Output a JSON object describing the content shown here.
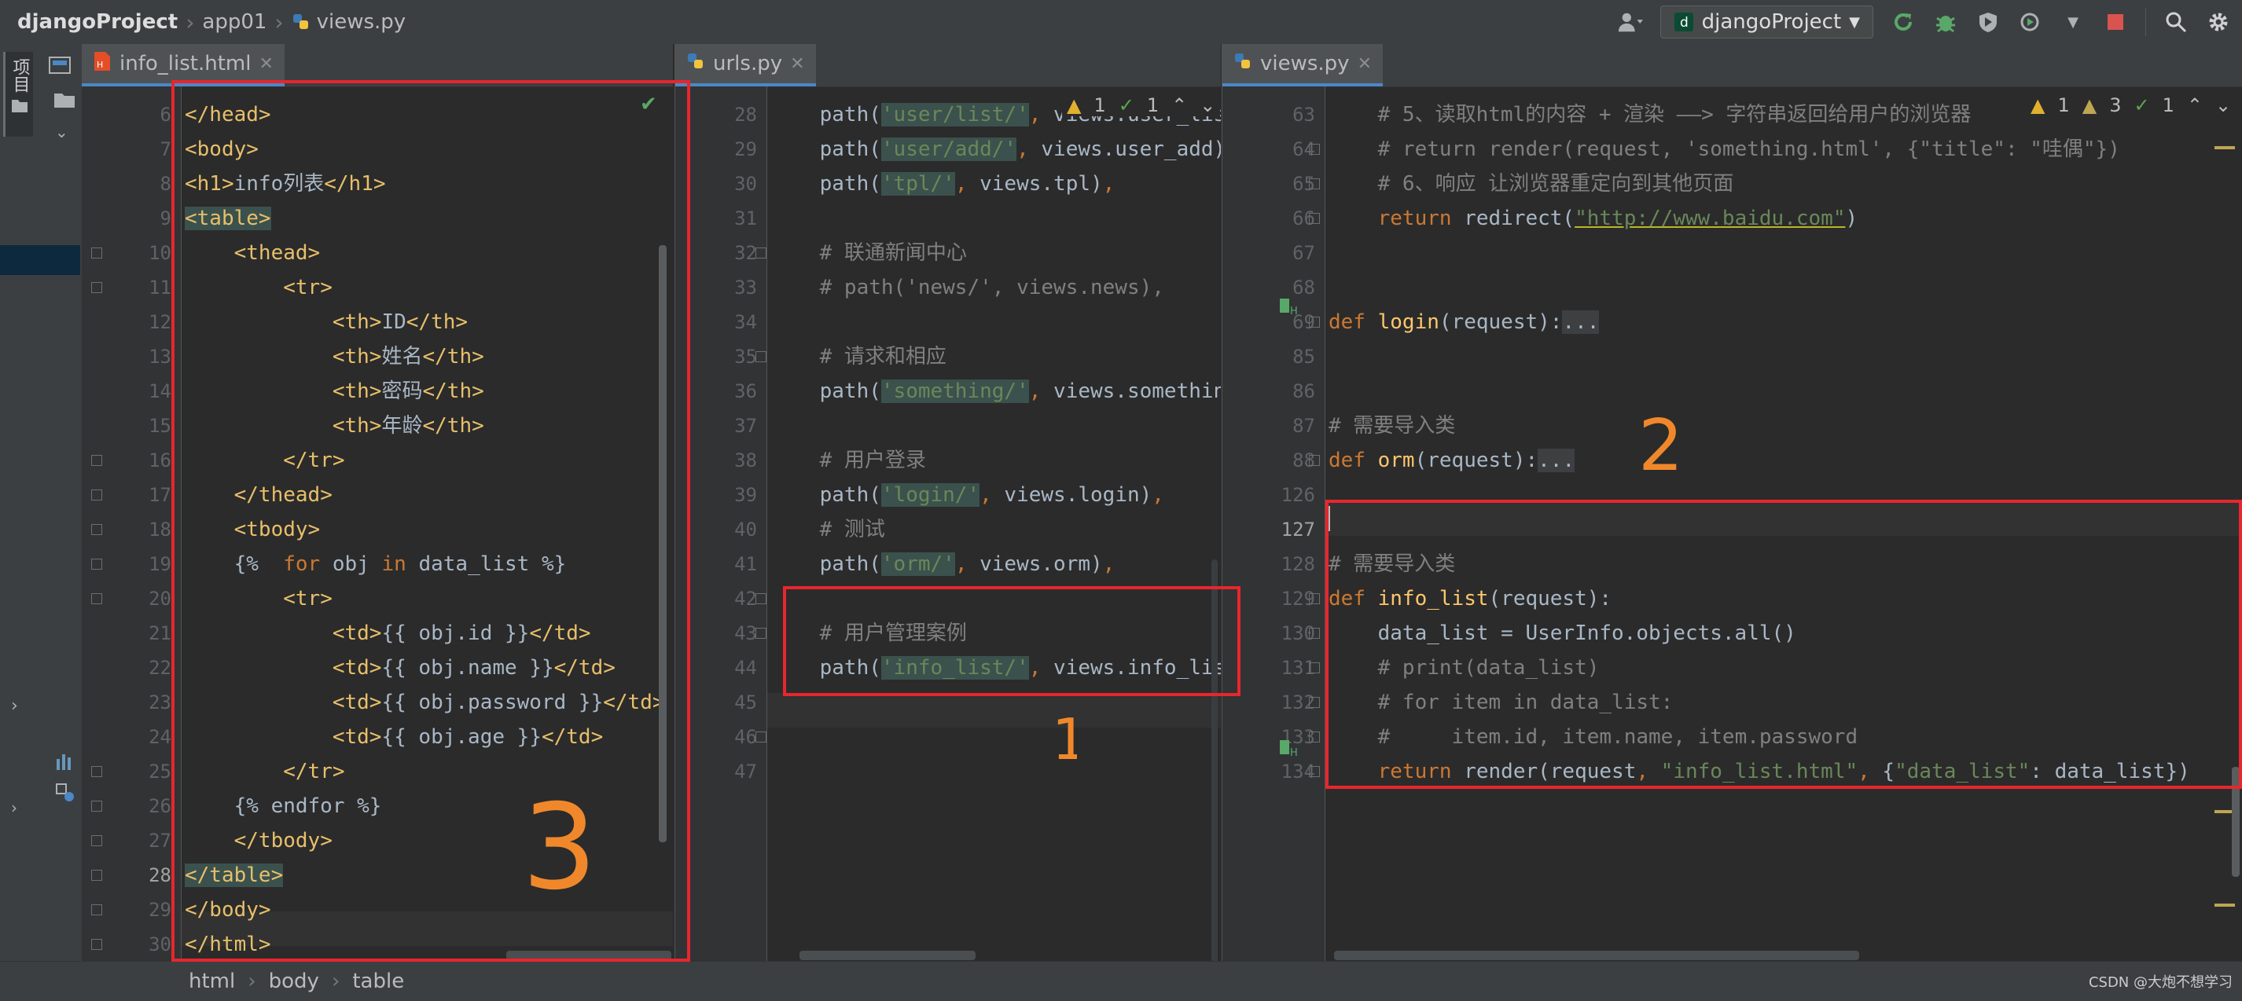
{
  "breadcrumb": {
    "project": "djangoProject",
    "folder": "app01",
    "file": "views.py"
  },
  "toolbar": {
    "run_config": "djangoProject"
  },
  "sidebar": {
    "project_label": "项目"
  },
  "panes": {
    "left": {
      "tab": "info_list.html",
      "line_numbers": [
        "6",
        "7",
        "8",
        "9",
        "10",
        "11",
        "12",
        "13",
        "14",
        "15",
        "16",
        "17",
        "18",
        "19",
        "20",
        "21",
        "22",
        "23",
        "24",
        "25",
        "26",
        "27",
        "28",
        "29",
        "30"
      ],
      "current_line": "28"
    },
    "middle": {
      "tab": "urls.py",
      "line_numbers": [
        "28",
        "29",
        "30",
        "31",
        "32",
        "33",
        "34",
        "35",
        "36",
        "37",
        "38",
        "39",
        "40",
        "41",
        "42",
        "43",
        "44",
        "45",
        "46",
        "47"
      ],
      "inspection": {
        "warnings": "1",
        "weak": "1"
      }
    },
    "right": {
      "tab": "views.py",
      "line_numbers": [
        "63",
        "64",
        "65",
        "66",
        "67",
        "68",
        "69",
        "85",
        "86",
        "87",
        "88",
        "126",
        "127",
        "128",
        "129",
        "130",
        "131",
        "132",
        "133",
        "134"
      ],
      "current_line": "127",
      "inspection": {
        "warnings": "1",
        "weak_warnings": "3",
        "typos": "1"
      }
    }
  },
  "code": {
    "left": [
      "</head>",
      "<body>",
      "<h1>info列表</h1>",
      "<table>",
      "    <thead>",
      "        <tr>",
      "            <th>ID</th>",
      "            <th>姓名</th>",
      "            <th>密码</th>",
      "            <th>年龄</th>",
      "        </tr>",
      "    </thead>",
      "    <tbody>",
      "    {%  for obj in data_list %}",
      "        <tr>",
      "            <td>{{ obj.id }}</td>",
      "            <td>{{ obj.name }}</td>",
      "            <td>{{ obj.password }}</td>",
      "            <td>{{ obj.age }}</td>",
      "        </tr>",
      "    {% endfor %}",
      "    </tbody>",
      "</table>",
      "</body>",
      "</html>"
    ],
    "middle": [
      "    path('user/list/', views.user_list),",
      "    path('user/add/', views.user_add),",
      "    path('tpl/', views.tpl),",
      "",
      "    # 联通新闻中心",
      "    # path('news/', views.news),",
      "",
      "    # 请求和相应",
      "    path('something/', views.something),",
      "",
      "    # 用户登录",
      "    path('login/', views.login),",
      "    # 测试",
      "    path('orm/', views.orm),",
      "",
      "    # 用户管理案例",
      "    path('info_list/', views.info_list),",
      "",
      "",
      ""
    ],
    "right": [
      "    # 5、读取html的内容 + 渲染 ——> 字符串返回给用户的浏览器",
      "    # return render(request, 'something.html', {\"title\": \"哇偶\"})",
      "    # 6、响应 让浏览器重定向到其他页面",
      "    return redirect(\"http://www.baidu.com\")",
      "",
      "",
      "def login(request):...",
      "",
      "",
      "# 需要导入类",
      "def orm(request):...",
      "",
      "",
      "# 需要导入类",
      "def info_list(request):",
      "    data_list = UserInfo.objects.all()",
      "    # print(data_list)",
      "    # for item in data_list:",
      "    #     item.id, item.name, item.password",
      "    return render(request, \"info_list.html\", {\"data_list\": data_list})"
    ]
  },
  "status": {
    "path": [
      "html",
      "body",
      "table"
    ],
    "watermark": "CSDN @大炮不想学习"
  },
  "annotations": {
    "mark1": "1",
    "mark2": "2",
    "mark3": "3"
  }
}
